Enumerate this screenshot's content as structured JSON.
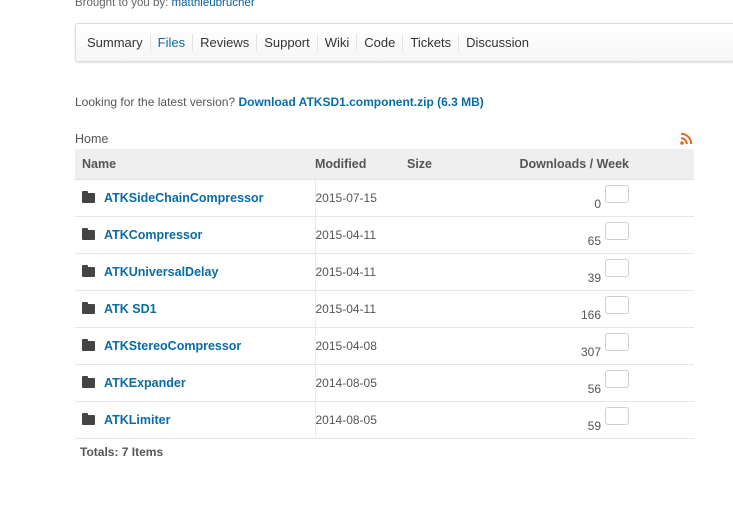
{
  "header": {
    "brought_prefix": "Brought to you by:",
    "brought_user": "matthieubrucher"
  },
  "tabs": [
    {
      "label": "Summary"
    },
    {
      "label": "Files"
    },
    {
      "label": "Reviews"
    },
    {
      "label": "Support"
    },
    {
      "label": "Wiki"
    },
    {
      "label": "Code"
    },
    {
      "label": "Tickets"
    },
    {
      "label": "Discussion"
    }
  ],
  "active_tab": "Files",
  "latest": {
    "prefix": "Looking for the latest version?",
    "link": "Download ATKSD1.component.zip (6.3 MB)"
  },
  "breadcrumb": "Home",
  "table": {
    "headers": {
      "name": "Name",
      "modified": "Modified",
      "size": "Size",
      "downloads": "Downloads / Week"
    },
    "rows": [
      {
        "name": "ATKSideChainCompressor",
        "modified": "2015-07-15",
        "size": "",
        "downloads": "0"
      },
      {
        "name": "ATKCompressor",
        "modified": "2015-04-11",
        "size": "",
        "downloads": "65"
      },
      {
        "name": "ATKUniversalDelay",
        "modified": "2015-04-11",
        "size": "",
        "downloads": "39"
      },
      {
        "name": "ATK SD1",
        "modified": "2015-04-11",
        "size": "",
        "downloads": "166"
      },
      {
        "name": "ATKStereoCompressor",
        "modified": "2015-04-08",
        "size": "",
        "downloads": "307"
      },
      {
        "name": "ATKExpander",
        "modified": "2014-08-05",
        "size": "",
        "downloads": "56"
      },
      {
        "name": "ATKLimiter",
        "modified": "2014-08-05",
        "size": "",
        "downloads": "59"
      }
    ]
  },
  "totals": "Totals: 7 Items",
  "colors": {
    "link": "#0b6ba5",
    "rss": "#e8661d"
  }
}
